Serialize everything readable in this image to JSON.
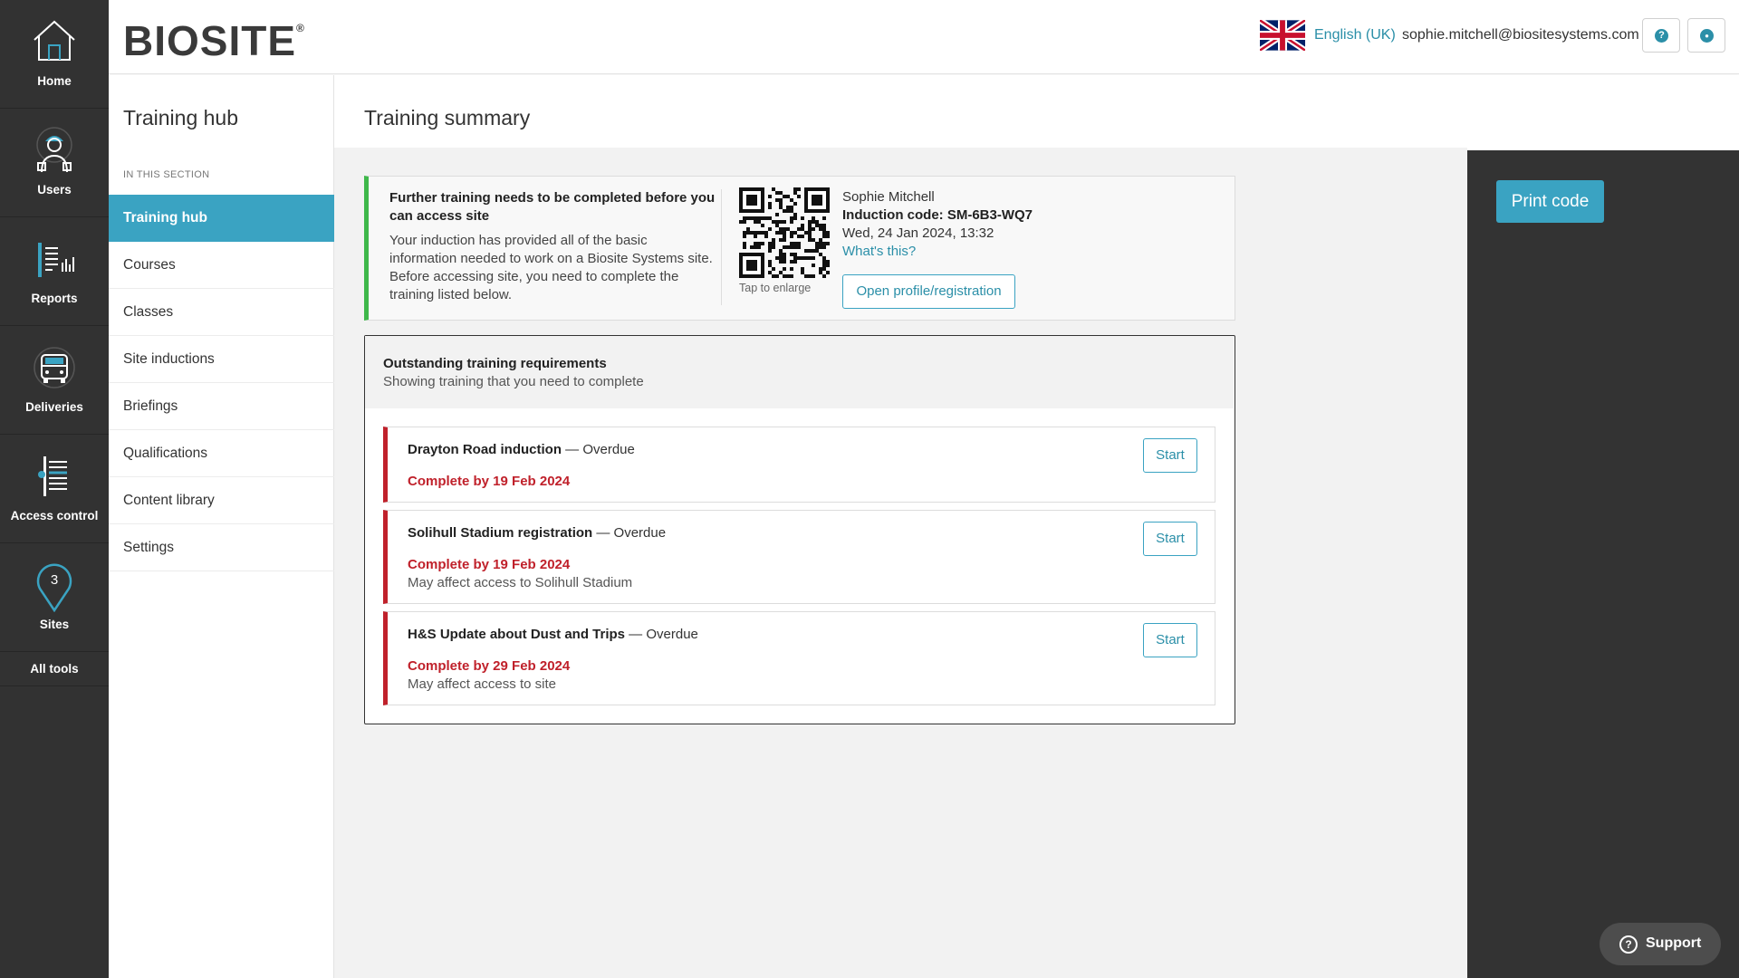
{
  "rail": {
    "items": [
      {
        "label": "Home",
        "icon": "home-icon"
      },
      {
        "label": "Users",
        "icon": "user-icon"
      },
      {
        "label": "Reports",
        "icon": "report-icon"
      },
      {
        "label": "Deliveries",
        "icon": "delivery-truck-icon"
      },
      {
        "label": "Access control",
        "icon": "turnstile-icon"
      },
      {
        "label": "Sites",
        "icon": "map-pin-icon",
        "badge": "3"
      }
    ],
    "all_tools": "All tools"
  },
  "header": {
    "logo": "BIOSITE",
    "logo_mark": "®",
    "language": "English (UK)",
    "email": "sophie.mitchell@biositesystems.com",
    "help_icon": "help-icon",
    "profile_icon": "profile-icon",
    "help_glyph": "?",
    "profile_glyph": "●"
  },
  "subnav": {
    "title": "Training hub",
    "section_label": "IN THIS SECTION",
    "items": [
      {
        "label": "Training hub",
        "active": true
      },
      {
        "label": "Courses"
      },
      {
        "label": "Classes"
      },
      {
        "label": "Site inductions"
      },
      {
        "label": "Briefings"
      },
      {
        "label": "Qualifications"
      },
      {
        "label": "Content library"
      },
      {
        "label": "Settings"
      }
    ]
  },
  "main": {
    "title": "Training summary",
    "alert": {
      "title": "Further training needs to be completed before you can access site",
      "body": "Your induction has provided all of the basic information needed to work on a Biosite Systems site. Before accessing site, you need to complete the training listed below.",
      "tap_to_enlarge": "Tap to enlarge",
      "name": "Sophie Mitchell",
      "induction_code": "Induction code: SM-6B3-WQ7",
      "date": "Wed, 24 Jan 2024, 13:32",
      "whats_this": "What's this?",
      "open_profile": "Open profile/registration"
    },
    "outstanding": {
      "title": "Outstanding training requirements",
      "subtitle": "Showing training that you need to complete",
      "items": [
        {
          "name": "Drayton Road induction",
          "status": " — Overdue",
          "due": "Complete by 19 Feb 2024",
          "note": "",
          "action": "Start"
        },
        {
          "name": "Solihull Stadium registration",
          "status": " — Overdue",
          "due": "Complete by 19 Feb 2024",
          "note": "May affect access to Solihull Stadium",
          "action": "Start"
        },
        {
          "name": "H&S Update about Dust and Trips",
          "status": " — Overdue",
          "due": "Complete by 29 Feb 2024",
          "note": "May affect access to site",
          "action": "Start"
        }
      ]
    }
  },
  "right_panel": {
    "print_code": "Print code"
  },
  "support": {
    "label": "Support",
    "glyph": "?"
  },
  "colors": {
    "accent": "#3aa3c2",
    "success": "#3eb84a",
    "danger": "#c0212b",
    "rail": "#323232"
  }
}
